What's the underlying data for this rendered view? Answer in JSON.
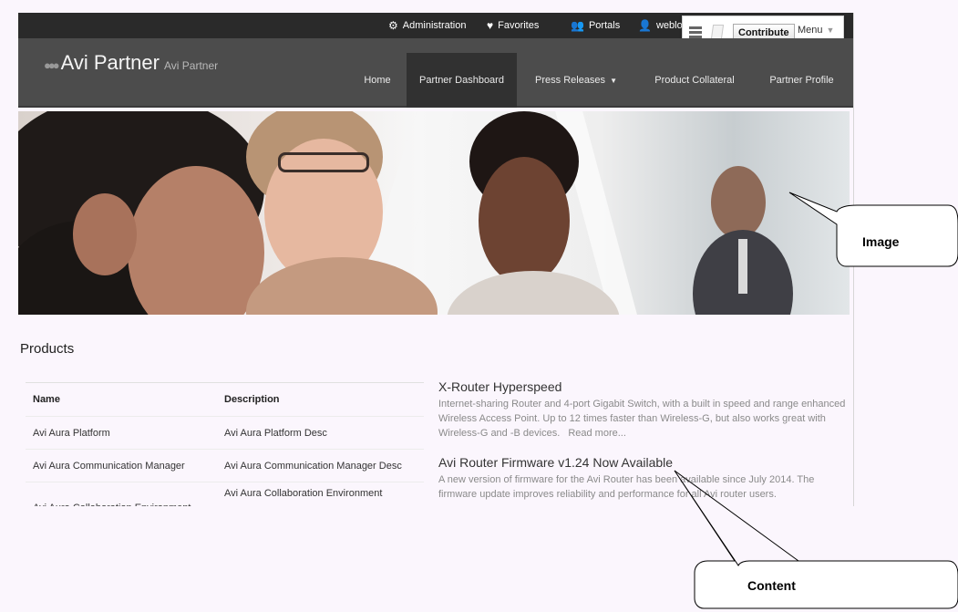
{
  "utility_bar": {
    "administration": "Administration",
    "favorites": "Favorites",
    "portals": "Portals",
    "user": "weblo"
  },
  "contribute_menu": {
    "contribute_label": "Contribute",
    "menu_label": "Menu"
  },
  "brand": {
    "title": "Avi Partner",
    "subtitle": "Avi Partner"
  },
  "nav": {
    "items": [
      {
        "label": "Home"
      },
      {
        "label": "Partner Dashboard",
        "active": true
      },
      {
        "label": "Press Releases"
      },
      {
        "label": "Product Collateral"
      },
      {
        "label": "Partner Profile"
      }
    ]
  },
  "products": {
    "title": "Products",
    "columns": [
      "Name",
      "Description"
    ],
    "rows": [
      [
        "Avi Aura Platform",
        "Avi Aura Platform Desc"
      ],
      [
        "Avi Aura Communication Manager",
        "Avi Aura Communication Manager Desc"
      ],
      [
        "Avi Aura Collaboration Environment",
        "Avi Aura Collaboration Environment"
      ]
    ]
  },
  "articles": [
    {
      "title": "X-Router Hyperspeed",
      "body": "Internet-sharing Router and 4-port Gigabit Switch, with a built in speed and range enhanced Wireless Access Point. Up to 12 times faster than Wireless-G, but also works great with Wireless-G and -B devices.",
      "read_more": "Read more..."
    },
    {
      "title": "Avi Router Firmware v1.24 Now Available",
      "body": "A new version of firmware for the Avi Router has been available since July 2014. The firmware update improves reliability and performance for all Avi router users."
    }
  ],
  "callouts": {
    "image": "Image",
    "content": "Content"
  }
}
